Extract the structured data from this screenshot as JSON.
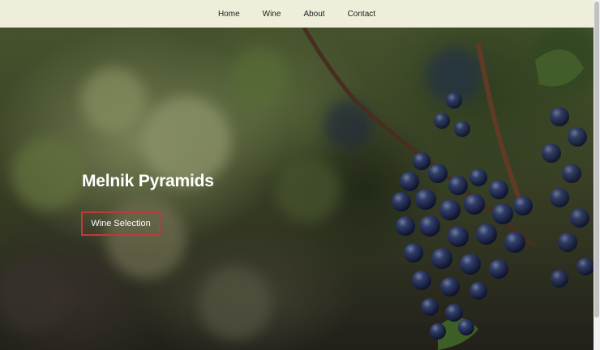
{
  "nav": {
    "items": [
      {
        "label": "Home"
      },
      {
        "label": "Wine"
      },
      {
        "label": "About"
      },
      {
        "label": "Contact"
      }
    ]
  },
  "hero": {
    "title": "Melnik Pyramids",
    "button_label": "Wine Selection",
    "background_image": "vineyard-grapes-photo"
  },
  "colors": {
    "nav_background": "#efeedb",
    "button_border": "#c0393b",
    "hero_text": "#ffffff"
  }
}
